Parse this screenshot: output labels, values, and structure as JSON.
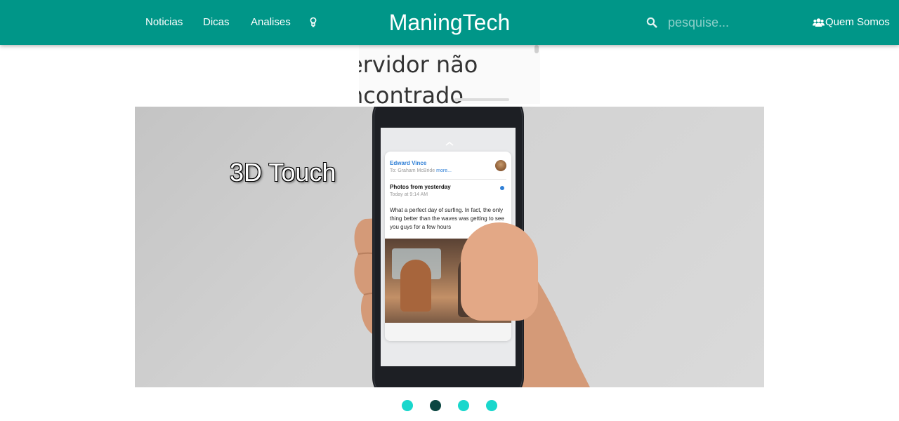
{
  "navbar": {
    "links": [
      {
        "label": "Noticias"
      },
      {
        "label": "Dicas"
      },
      {
        "label": "Analises"
      }
    ],
    "bulb_icon": "lightbulb-icon",
    "brand": "ManingTech",
    "search": {
      "icon": "search-icon",
      "placeholder": "pesquise...",
      "value": ""
    },
    "about": {
      "icon": "users-icon",
      "label": "Quem Somos"
    },
    "background_color": "#009688"
  },
  "embed_error": {
    "text": "ervidor não\nncontrado"
  },
  "slider": {
    "caption": "3D Touch",
    "phone_email": {
      "sender": "Edward Vince",
      "to": "To: Graham McBride",
      "more": "more...",
      "subject": "Photos from yesterday",
      "time": "Today at 9:14 AM",
      "body": "What a perfect day of surfing. In fact, the only thing better than the waves was getting to see you guys for a few hours"
    },
    "indicators": {
      "count": 4,
      "active_index": 2,
      "color": "#19d7cc",
      "active_color": "#0b4641"
    }
  }
}
